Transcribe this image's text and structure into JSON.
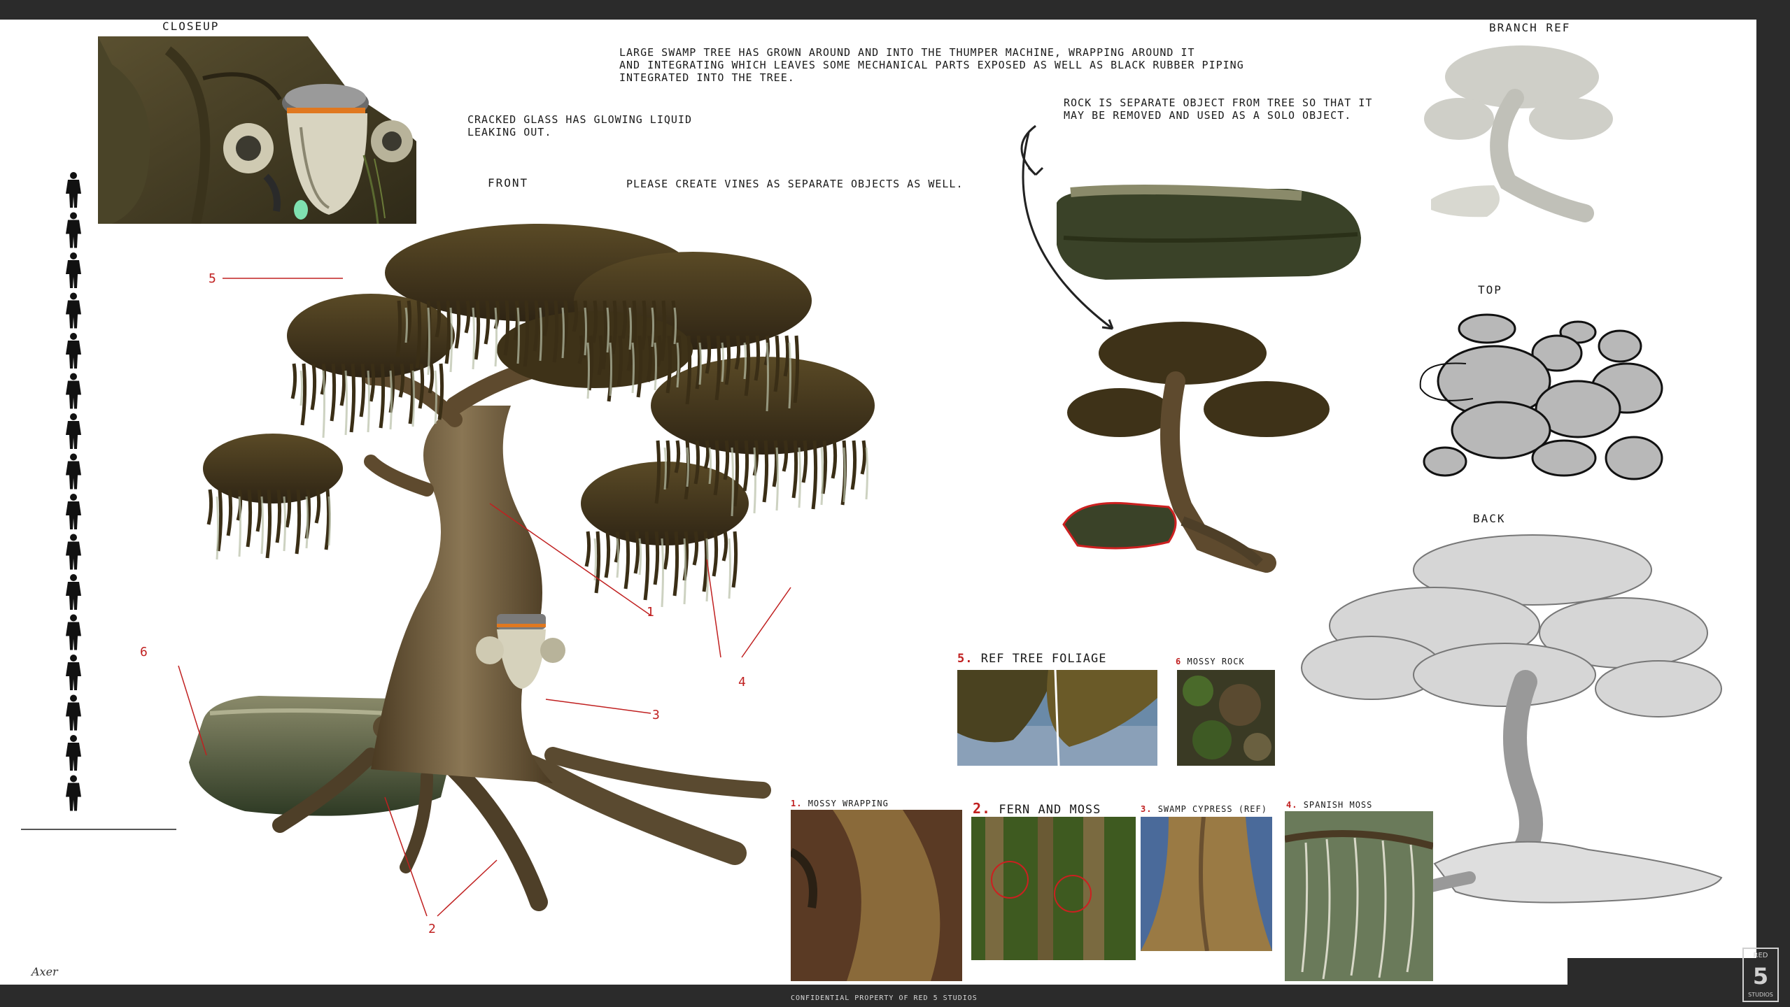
{
  "labels": {
    "closeup": "CLOSEUP",
    "front": "FRONT",
    "branch_ref": "BRANCH REF",
    "top": "TOP",
    "back": "BACK"
  },
  "notes": {
    "main_line1": "LARGE SWAMP TREE HAS GROWN AROUND AND INTO THE THUMPER MACHINE, WRAPPING AROUND IT",
    "main_line2": "AND INTEGRATING WHICH LEAVES SOME MECHANICAL PARTS EXPOSED AS WELL AS BLACK RUBBER PIPING",
    "main_line3": "INTEGRATED INTO THE TREE.",
    "glass_line1": "CRACKED GLASS HAS GLOWING LIQUID",
    "glass_line2": "LEAKING OUT.",
    "vines": "PLEASE CREATE VINES AS SEPARATE OBJECTS AS WELL.",
    "rock_line1": "ROCK IS SEPARATE OBJECT FROM TREE SO THAT IT",
    "rock_line2": "MAY BE REMOVED AND USED AS A SOLO OBJECT."
  },
  "callouts": [
    "5",
    "1",
    "4",
    "3",
    "6",
    "2"
  ],
  "references": [
    {
      "num": "5.",
      "label": "REF TREE FOLIAGE"
    },
    {
      "num": "6",
      "label": "MOSSY ROCK"
    },
    {
      "num": "1.",
      "label": "MOSSY WRAPPING"
    },
    {
      "num": "2.",
      "label": "FERN AND MOSS"
    },
    {
      "num": "3.",
      "label": "SWAMP CYPRESS (REF)"
    },
    {
      "num": "4.",
      "label": "SPANISH MOSS"
    }
  ],
  "footer": "CONFIDENTIAL PROPERTY OF RED 5 STUDIOS",
  "signature": "Axer",
  "logo_text": "5",
  "logo_text_side": "STUDIOS",
  "logo_text_top": "RED",
  "colors": {
    "accent": "#c02020",
    "sheet": "#ffffff",
    "border": "#2b2b2b"
  }
}
